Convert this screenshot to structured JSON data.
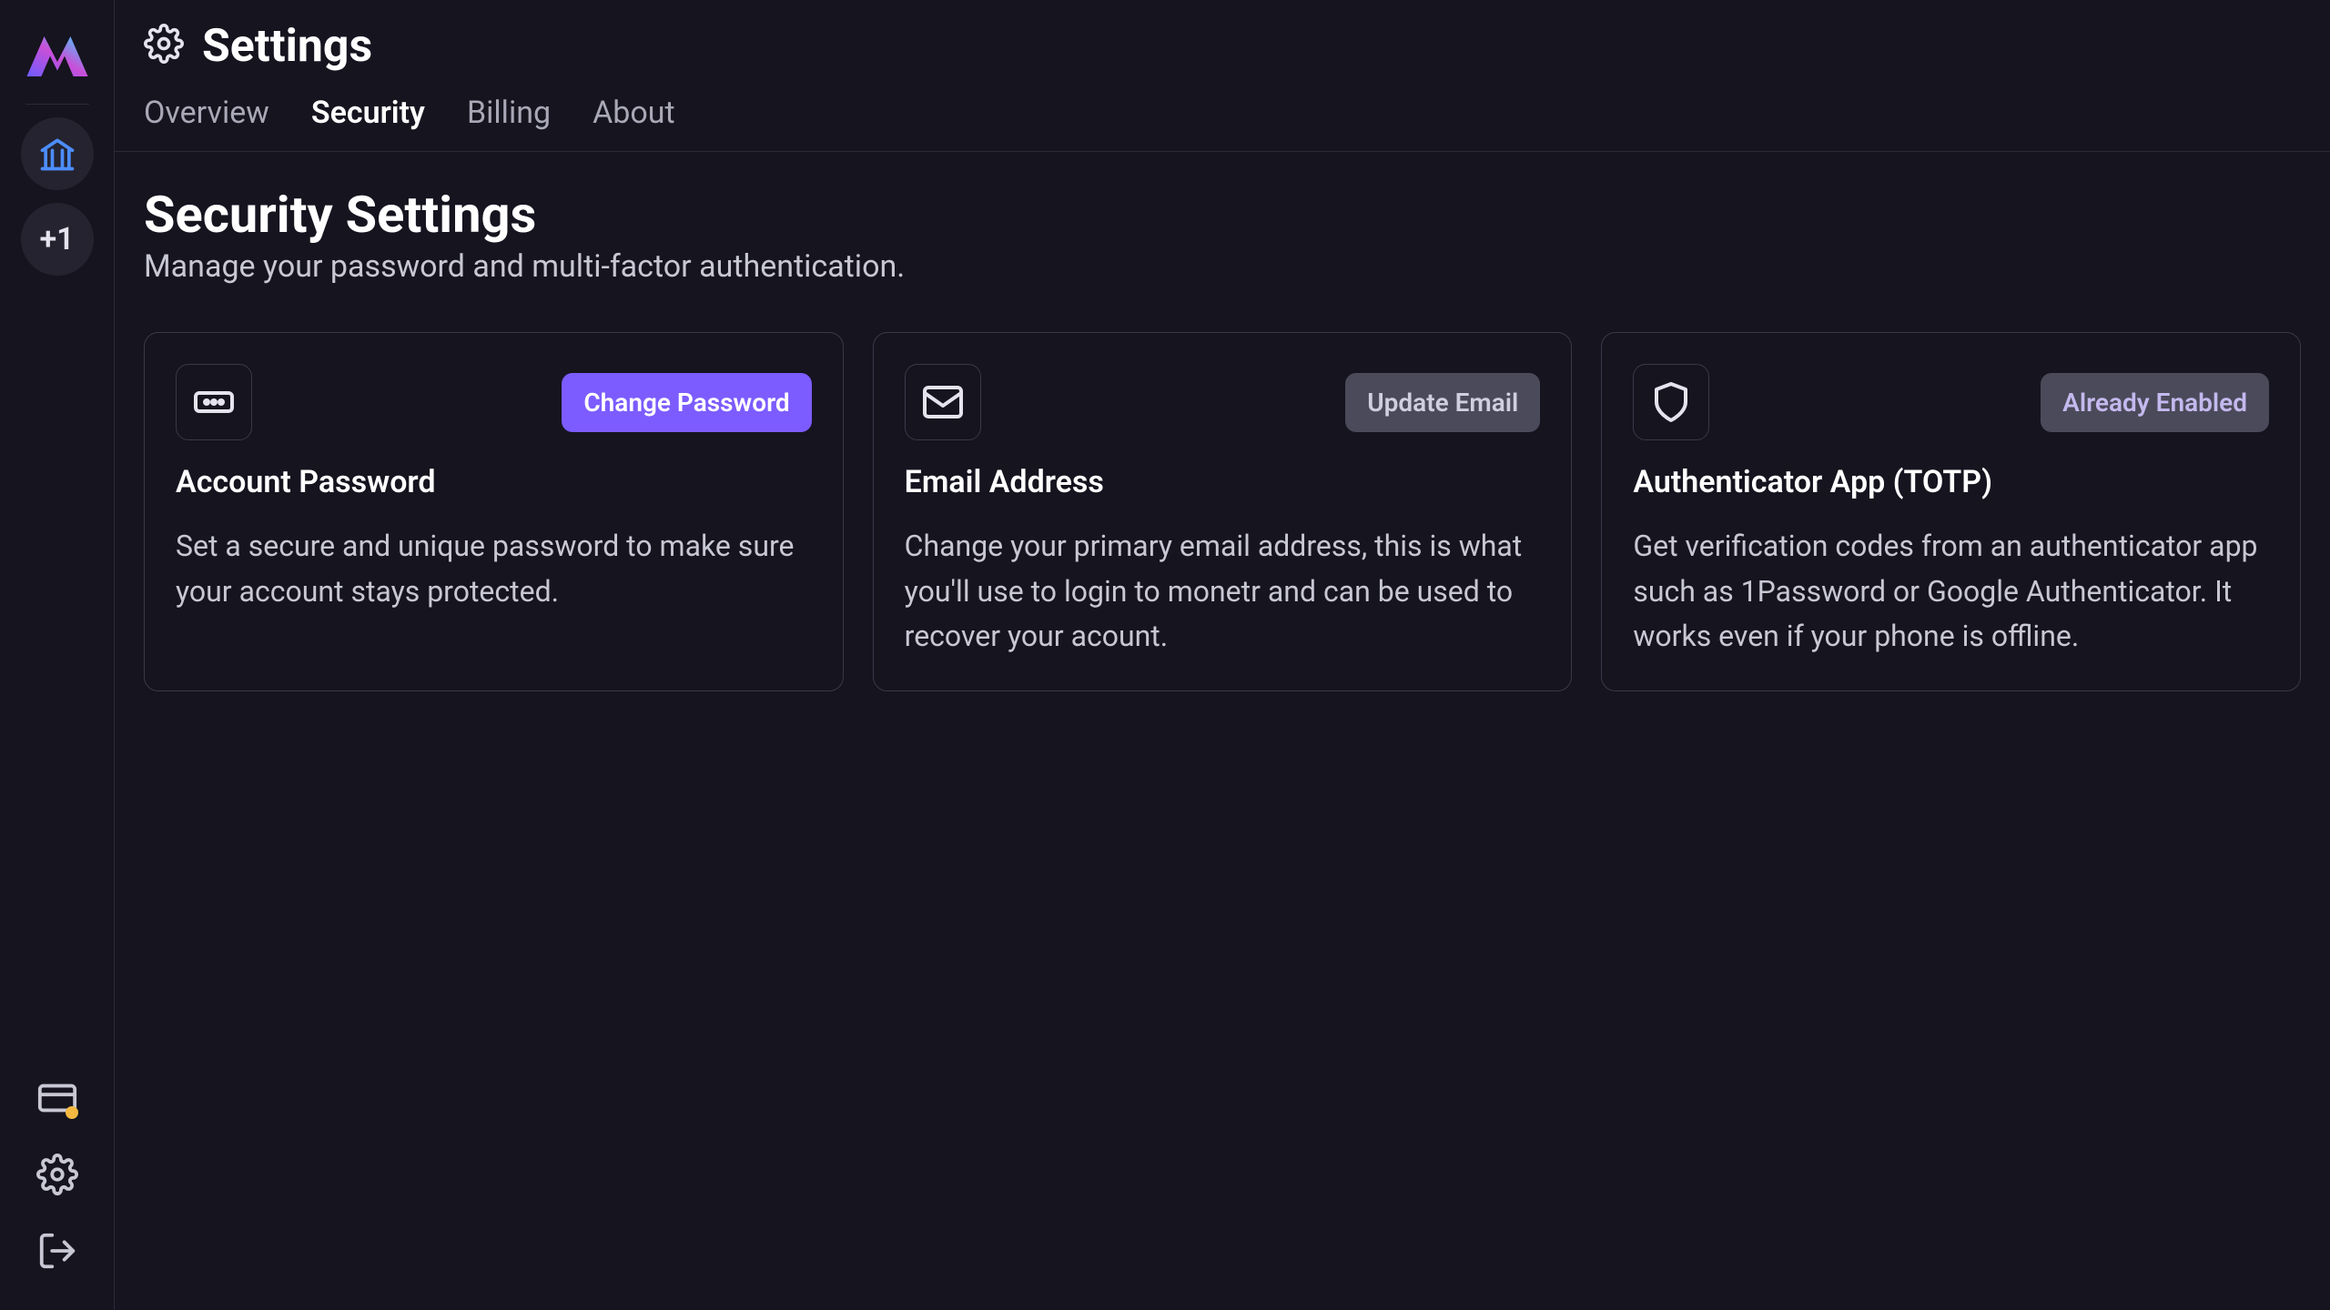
{
  "sidebar": {
    "add_label": "+1"
  },
  "header": {
    "title": "Settings"
  },
  "tabs": [
    {
      "id": "overview",
      "label": "Overview",
      "active": false
    },
    {
      "id": "security",
      "label": "Security",
      "active": true
    },
    {
      "id": "billing",
      "label": "Billing",
      "active": false
    },
    {
      "id": "about",
      "label": "About",
      "active": false
    }
  ],
  "section": {
    "title": "Security Settings",
    "subtitle": "Manage your password and multi-factor authentication."
  },
  "cards": {
    "password": {
      "title": "Account Password",
      "desc": "Set a secure and unique password to make sure your account stays protected.",
      "button": "Change Password"
    },
    "email": {
      "title": "Email Address",
      "desc": "Change your primary email address, this is what you'll use to login to monetr and can be used to recover your acount.",
      "button": "Update Email"
    },
    "totp": {
      "title": "Authenticator App (TOTP)",
      "desc": "Get verification codes from an authenticator app such as 1Password or Google Authenticator. It works even if your phone is offline.",
      "button": "Already Enabled"
    }
  }
}
